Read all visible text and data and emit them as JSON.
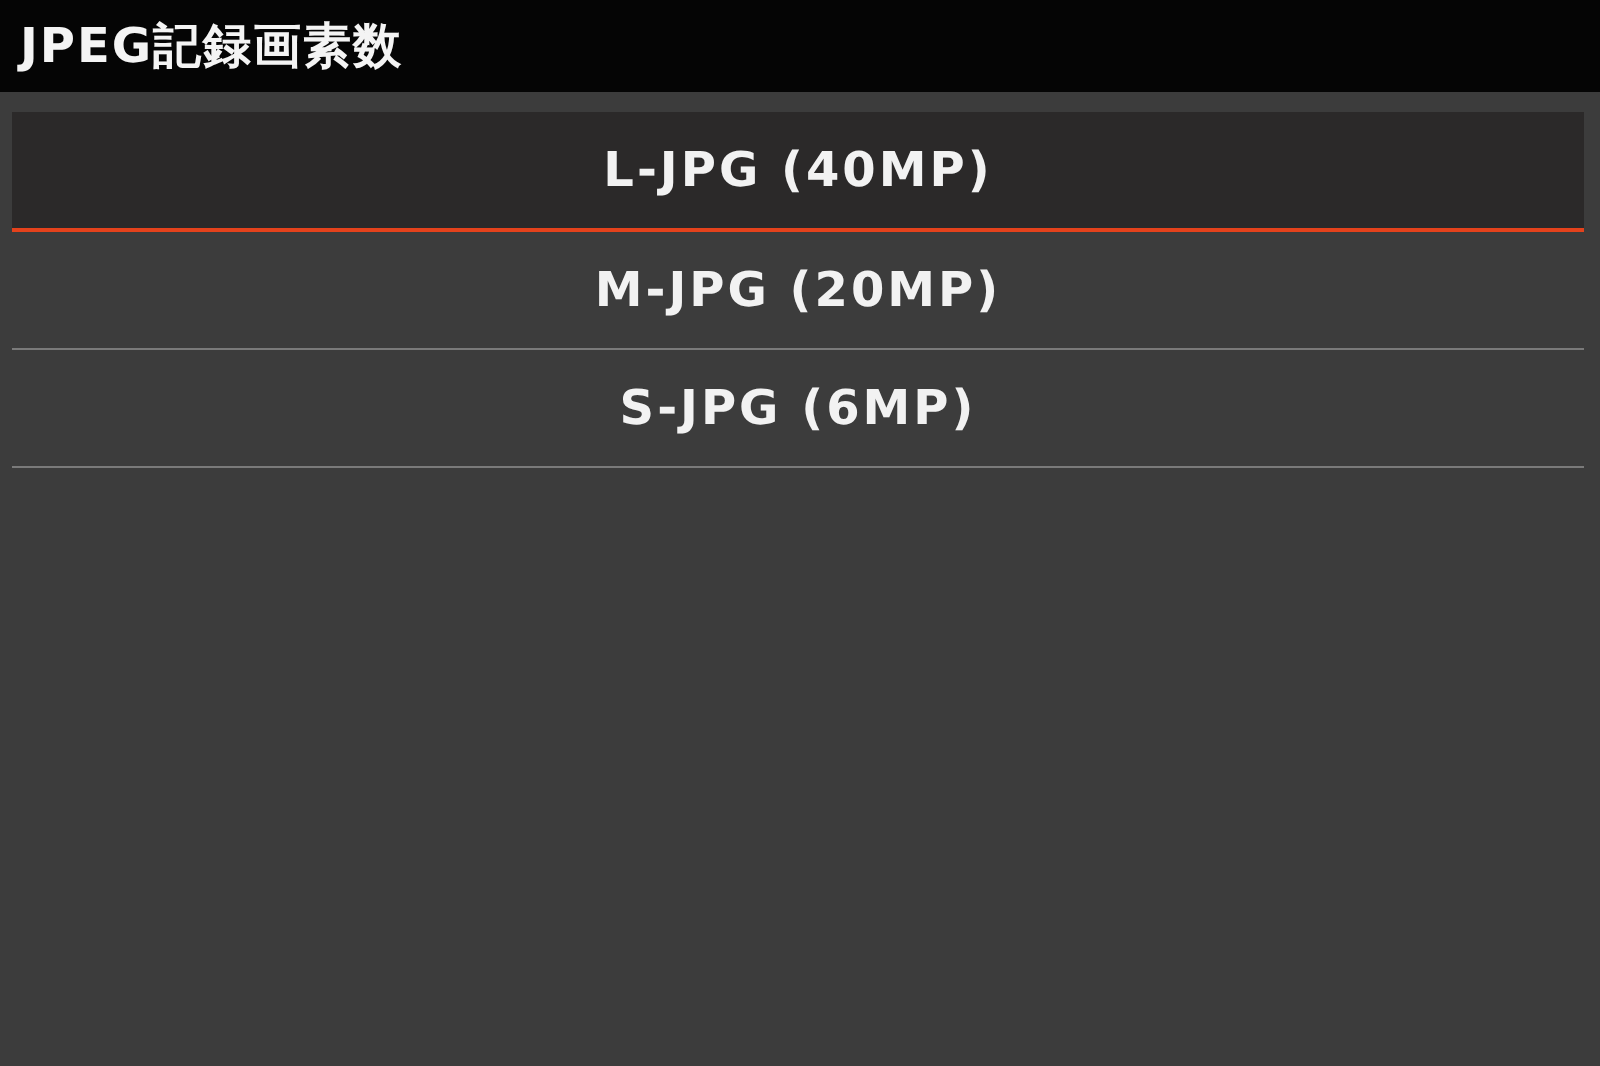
{
  "header": {
    "title": "JPEG記録画素数"
  },
  "options": [
    {
      "label": "L-JPG (40MP)",
      "selected": true
    },
    {
      "label": "M-JPG (20MP)",
      "selected": false
    },
    {
      "label": "S-JPG (6MP)",
      "selected": false
    }
  ]
}
